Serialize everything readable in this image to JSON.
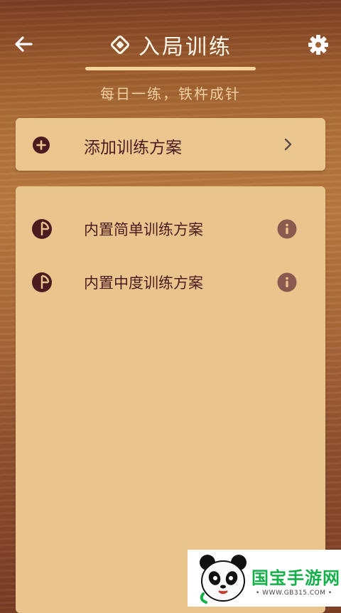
{
  "header": {
    "title": "入局训练",
    "subtitle": "每日一练，铁杵成针",
    "back_icon": "arrow-left-icon",
    "settings_icon": "gear-icon",
    "title_icon": "diamond-outline-icon"
  },
  "add_plan": {
    "label": "添加训练方案",
    "icon": "plus-circle-icon",
    "chevron_icon": "chevron-right-icon"
  },
  "plans": [
    {
      "label": "内置简单训练方案",
      "icon": "pie-chart-icon",
      "info_icon": "info-icon"
    },
    {
      "label": "内置中度训练方案",
      "icon": "pie-chart-icon",
      "info_icon": "info-icon"
    }
  ],
  "watermark": {
    "text": "国宝手游网",
    "url": "• WWW.GB315.COM •"
  },
  "colors": {
    "card": "#ebc78f",
    "text_dark": "#4a1c20",
    "title": "#fff8ea",
    "subtitle": "#f0cfa2",
    "accent_line": "#f3d39b",
    "info": "#8a5a4e"
  }
}
